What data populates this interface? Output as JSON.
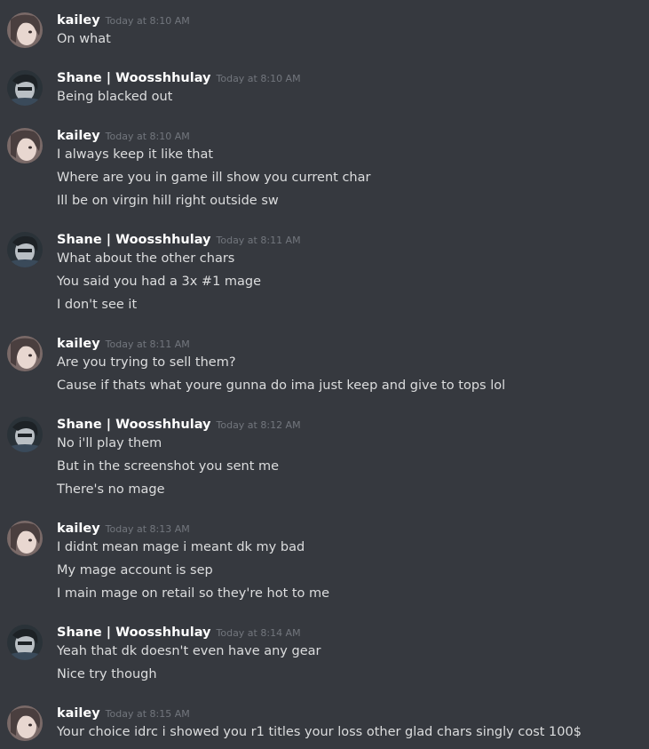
{
  "messages": [
    {
      "author": "kailey",
      "timestamp": "Today at 8:10 AM",
      "lines": [
        "On what"
      ]
    },
    {
      "author": "Shane | Woosshhulay",
      "timestamp": "Today at 8:10 AM",
      "lines": [
        "Being blacked out"
      ]
    },
    {
      "author": "kailey",
      "timestamp": "Today at 8:10 AM",
      "lines": [
        "I always keep it like that",
        "Where are you in game ill show you current char",
        "Ill be on virgin hill right outside sw"
      ]
    },
    {
      "author": "Shane | Woosshhulay",
      "timestamp": "Today at 8:11 AM",
      "lines": [
        "What about the other chars",
        "You said you had a 3x #1 mage",
        "I don't see it"
      ]
    },
    {
      "author": "kailey",
      "timestamp": "Today at 8:11 AM",
      "lines": [
        "Are you trying to sell them?",
        "Cause if thats what youre gunna do ima just keep and give to tops lol"
      ]
    },
    {
      "author": "Shane | Woosshhulay",
      "timestamp": "Today at 8:12 AM",
      "lines": [
        "No i'll play them",
        "But in the screenshot you sent me",
        "There's no mage"
      ]
    },
    {
      "author": "kailey",
      "timestamp": "Today at 8:13 AM",
      "lines": [
        "I didnt mean mage i meant dk my bad",
        "My mage account is sep",
        "I main mage on retail so they're hot to me"
      ]
    },
    {
      "author": "Shane | Woosshhulay",
      "timestamp": "Today at 8:14 AM",
      "lines": [
        "Yeah that dk doesn't even have any gear",
        "Nice try though"
      ]
    },
    {
      "author": "kailey",
      "timestamp": "Today at 8:15 AM",
      "lines": [
        "Your choice idrc i showed you r1 titles your loss other glad chars singly cost 100$"
      ]
    }
  ]
}
